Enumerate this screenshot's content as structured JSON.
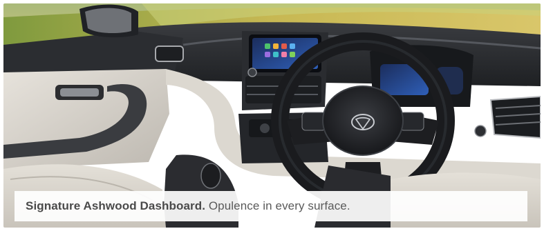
{
  "caption": {
    "title": "Signature Ashwood Dashboard.",
    "text": "Opulence in every surface."
  },
  "colors": {
    "caption_background": "#ffffff",
    "caption_text": "#5a5a5a",
    "dashboard_dark": "#2a2c30",
    "dashboard_light": "#d9d6d0",
    "screen_accent": "#3b7be0"
  },
  "icons": {
    "steering_logo": "tata-logo-icon"
  }
}
